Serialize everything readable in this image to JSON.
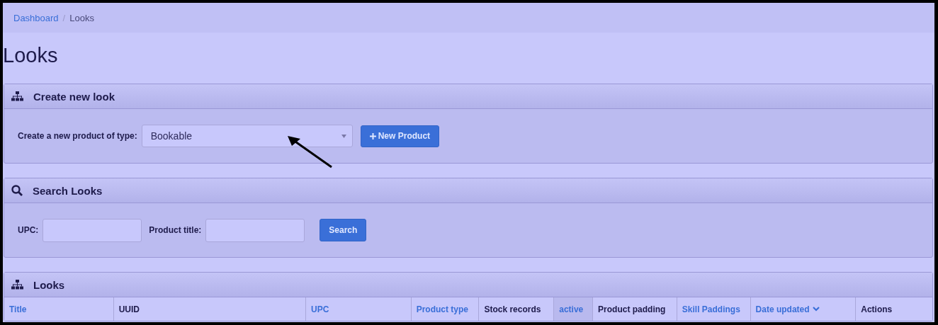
{
  "breadcrumb_separator": "/",
  "breadcrumb": [
    {
      "label": "Dashboard",
      "kind": "link"
    },
    {
      "label": "Looks",
      "kind": "current"
    }
  ],
  "page_title": "Looks",
  "create_panel": {
    "title": "Create new look",
    "label": "Create a new product of type:",
    "select_value": "Bookable",
    "button": "New Product"
  },
  "search_panel": {
    "title": "Search Looks",
    "fields": [
      {
        "label": "UPC:"
      },
      {
        "label": "Product title:"
      }
    ],
    "button": "Search"
  },
  "looks_panel": {
    "title": "Looks",
    "columns": [
      {
        "label": "Title",
        "sortable": true,
        "highlighted": false,
        "sorted": false
      },
      {
        "label": "UUID",
        "sortable": false,
        "highlighted": false,
        "sorted": false
      },
      {
        "label": "UPC",
        "sortable": true,
        "highlighted": false,
        "sorted": false
      },
      {
        "label": "Product type",
        "sortable": true,
        "highlighted": false,
        "sorted": false
      },
      {
        "label": "Stock records",
        "sortable": false,
        "highlighted": false,
        "sorted": false
      },
      {
        "label": "active",
        "sortable": true,
        "highlighted": true,
        "sorted": false
      },
      {
        "label": "Product padding",
        "sortable": false,
        "highlighted": false,
        "sorted": false
      },
      {
        "label": "Skill Paddings",
        "sortable": true,
        "highlighted": false,
        "sorted": false
      },
      {
        "label": "Date updated",
        "sortable": true,
        "highlighted": false,
        "sorted": true
      },
      {
        "label": "Actions",
        "sortable": false,
        "highlighted": false,
        "sorted": false
      }
    ]
  }
}
